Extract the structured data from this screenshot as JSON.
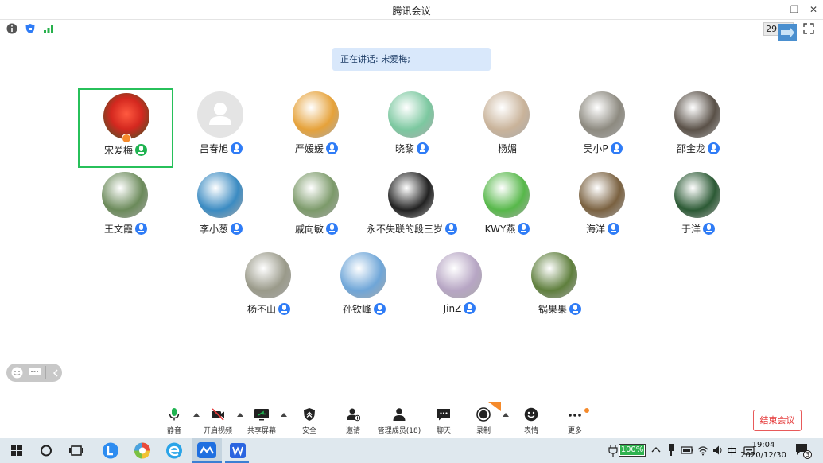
{
  "window": {
    "title": "腾讯会议",
    "controls": [
      "minimize-icon",
      "restore-icon",
      "close-icon"
    ]
  },
  "infobar": {
    "timer": "29:26"
  },
  "speaking_banner": "正在讲话: 宋爱梅;",
  "participants": [
    {
      "name": "宋爱梅",
      "mic": "speaking",
      "active": true,
      "color": "#d4281f"
    },
    {
      "name": "吕春旭",
      "mic": "on",
      "color": "#dddddd"
    },
    {
      "name": "严媛媛",
      "mic": "on",
      "color": "#e6a23a"
    },
    {
      "name": "晓黎",
      "mic": "on",
      "color": "#7cc8a0"
    },
    {
      "name": "杨媚",
      "mic": "none",
      "color": "#c9b39a"
    },
    {
      "name": "吴小P",
      "mic": "on",
      "color": "#8d8a80"
    },
    {
      "name": "邵金龙",
      "mic": "on",
      "color": "#5a5148"
    },
    {
      "name": "王文霞",
      "mic": "on",
      "color": "#6b8a5a"
    },
    {
      "name": "李小葱",
      "mic": "on",
      "color": "#3b8bc2"
    },
    {
      "name": "戚向敏",
      "mic": "on",
      "color": "#7c9a6a"
    },
    {
      "name": "永不失联的段三岁",
      "mic": "on",
      "color": "#222222"
    },
    {
      "name": "KWY燕",
      "mic": "on",
      "color": "#57b84a"
    },
    {
      "name": "海洋",
      "mic": "on",
      "color": "#7a6140"
    },
    {
      "name": "于洋",
      "mic": "on",
      "color": "#2c5a35"
    },
    {
      "name": "杨丕山",
      "mic": "on",
      "color": "#9a9a8a"
    },
    {
      "name": "孙钦峰",
      "mic": "on",
      "color": "#6fa6d8"
    },
    {
      "name": "JinZ",
      "mic": "on",
      "color": "#b7a6c4"
    },
    {
      "name": "一锅果果",
      "mic": "on",
      "color": "#5f7f3d"
    }
  ],
  "toolbar": {
    "mute": "静音",
    "video": "开启视频",
    "share": "共享屏幕",
    "security": "安全",
    "invite": "邀请",
    "members": "管理成员(18)",
    "chat": "聊天",
    "record": "录制",
    "reactions": "表情",
    "more": "更多",
    "end": "结束会议"
  },
  "taskbar": {
    "battery": "100%",
    "ime": "中",
    "time": "19:04",
    "date": "2020/12/30",
    "notification_count": "3"
  },
  "colors": {
    "accent_blue": "#2f7cf6",
    "speaking_green": "#1fb350",
    "end_red": "#e53b3b"
  }
}
